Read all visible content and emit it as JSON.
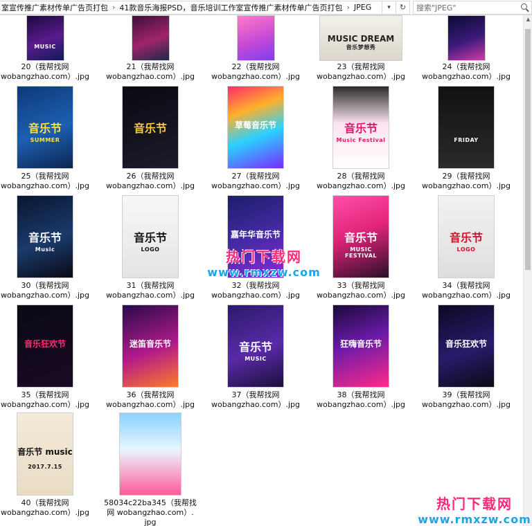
{
  "address_bar": {
    "crumbs": [
      "室宣传推广素材传单广告页打包",
      "41款音乐海报PSD，音乐培训工作室宣传推广素材传单广告页打包",
      "JPEG"
    ],
    "separator": "›",
    "search_placeholder": "搜索\"JPEG\""
  },
  "files": [
    {
      "num": "20",
      "name_line1": "20（我帮找网",
      "name_line2": "wobangzhao.com）.jpg",
      "poster_title": "",
      "poster_sub": "MUSIC",
      "bg": "linear-gradient(160deg,#1a0b3d,#5a1a8f 55%,#0d1c55)",
      "fg": "#ffffff"
    },
    {
      "num": "21",
      "name_line1": "21（我帮找网",
      "name_line2": "wobangzhao.com）.jpg",
      "poster_title": "",
      "poster_sub": "",
      "bg": "linear-gradient(160deg,#3d0f3a,#a0246a 55%,#1b2a4a)",
      "fg": "#ffd6ef"
    },
    {
      "num": "22",
      "name_line1": "22（我帮找网",
      "name_line2": "wobangzhao.com）.jpg",
      "poster_title": "",
      "poster_sub": "",
      "bg": "linear-gradient(160deg,#ff7ac8,#c64ad6 55%,#7f3cf0)",
      "fg": "#ffffff"
    },
    {
      "num": "23",
      "name_line1": "23（我帮找网",
      "name_line2": "wobangzhao.com）.jpg",
      "poster_title": "MUSIC DREAM",
      "poster_sub": "音乐梦想秀",
      "bg": "linear-gradient(180deg,#f4f1ea,#dcd7cb)",
      "fg": "#222222"
    },
    {
      "num": "24",
      "name_line1": "24（我帮找网",
      "name_line2": "wobangzhao.com）.jpg",
      "poster_title": "",
      "poster_sub": "",
      "bg": "linear-gradient(160deg,#0c0a2f,#3b1a7c 55%,#d23aa6)",
      "fg": "#ffffff"
    },
    {
      "num": "25",
      "name_line1": "25（我帮找网",
      "name_line2": "wobangzhao.com）.jpg",
      "poster_title": "音乐节",
      "poster_sub": "SUMMER",
      "bg": "linear-gradient(160deg,#0d3a7a,#1d5fb0 55%,#0b2550)",
      "fg": "#ffe23a"
    },
    {
      "num": "26",
      "name_line1": "26（我帮找网",
      "name_line2": "wobangzhao.com）.jpg",
      "poster_title": "音乐节",
      "poster_sub": "",
      "bg": "linear-gradient(160deg,#0a0a14,#1b1b2a)",
      "fg": "#ffc83a"
    },
    {
      "num": "27",
      "name_line1": "27（我帮找网",
      "name_line2": "wobangzhao.com）.jpg",
      "poster_title": "草莓音乐节",
      "poster_sub": "",
      "bg": "linear-gradient(160deg,#ff2a6d,#ffb02a 30%,#2ad1ff 60%,#7a2aff)",
      "fg": "#ffffff"
    },
    {
      "num": "28",
      "name_line1": "28（我帮找网",
      "name_line2": "wobangzhao.com）.jpg",
      "poster_title": "音乐节",
      "poster_sub": "Music Festival",
      "bg": "linear-gradient(180deg,#2a2a2a,#fbe3ef 45%,#ffffff)",
      "fg": "#e0156a"
    },
    {
      "num": "29",
      "name_line1": "29（我帮找网",
      "name_line2": "wobangzhao.com）.jpg",
      "poster_title": "",
      "poster_sub": "FRIDAY",
      "bg": "linear-gradient(180deg,#111111,#2a2a2a)",
      "fg": "#ffffff"
    },
    {
      "num": "30",
      "name_line1": "30（我帮找网",
      "name_line2": "wobangzhao.com）.jpg",
      "poster_title": "音乐节",
      "poster_sub": "Music",
      "bg": "linear-gradient(160deg,#0a1630,#1a3a6b 55%,#0a0a14)",
      "fg": "#ffffff"
    },
    {
      "num": "31",
      "name_line1": "31（我帮找网",
      "name_line2": "wobangzhao.com）.jpg",
      "poster_title": "音乐节",
      "poster_sub": "LOGO",
      "bg": "linear-gradient(180deg,#f7f7f7,#e4e4e4)",
      "fg": "#111111"
    },
    {
      "num": "32",
      "name_line1": "32（我帮找网",
      "name_line2": "wobangzhao.com）.jpg",
      "poster_title": "嘉年华音乐节",
      "poster_sub": "",
      "bg": "linear-gradient(160deg,#1a1f6b,#4a2aa8 55%,#8a2ad6)",
      "fg": "#ffffff"
    },
    {
      "num": "33",
      "name_line1": "33（我帮找网",
      "name_line2": "wobangzhao.com）.jpg",
      "poster_title": "音乐节",
      "poster_sub": "MUSIC FESTIVAL",
      "bg": "linear-gradient(160deg,#ff4fa8,#e1247a 45%,#2a0f2a)",
      "fg": "#ffffff"
    },
    {
      "num": "34",
      "name_line1": "34（我帮找网",
      "name_line2": "wobangzhao.com）.jpg",
      "poster_title": "音乐节",
      "poster_sub": "LOGO",
      "bg": "linear-gradient(180deg,#f2f2f2,#dedede)",
      "fg": "#d0102a"
    },
    {
      "num": "35",
      "name_line1": "35（我帮找网",
      "name_line2": "wobangzhao.com）.jpg",
      "poster_title": "音乐狂欢节",
      "poster_sub": "",
      "bg": "linear-gradient(160deg,#0a0a14,#1a0a24)",
      "fg": "#ff2a6d"
    },
    {
      "num": "36",
      "name_line1": "36（我帮找网",
      "name_line2": "wobangzhao.com）.jpg",
      "poster_title": "迷笛音乐节",
      "poster_sub": "",
      "bg": "linear-gradient(160deg,#2a0a4a,#b01a8a 55%,#ff7a2a)",
      "fg": "#ffffff"
    },
    {
      "num": "37",
      "name_line1": "37（我帮找网",
      "name_line2": "wobangzhao.com）.jpg",
      "poster_title": "音乐节",
      "poster_sub": "MUSIC",
      "bg": "linear-gradient(160deg,#2a1a6b,#5a2aa8 55%,#1a0f3a)",
      "fg": "#ffffff"
    },
    {
      "num": "38",
      "name_line1": "38（我帮找网",
      "name_line2": "wobangzhao.com）.jpg",
      "poster_title": "狂嗨音乐节",
      "poster_sub": "",
      "bg": "linear-gradient(160deg,#1a0a3a,#6a1aa8 45%,#ff2a8a)",
      "fg": "#ffffff"
    },
    {
      "num": "39",
      "name_line1": "39（我帮找网",
      "name_line2": "wobangzhao.com）.jpg",
      "poster_title": "音乐狂欢节",
      "poster_sub": "",
      "bg": "linear-gradient(160deg,#0a0a24,#2a1a6b 55%,#0a0a14)",
      "fg": "#ffffff"
    },
    {
      "num": "40",
      "name_line1": "40（我帮找网",
      "name_line2": "wobangzhao.com）.jpg",
      "poster_title": "音乐节 music",
      "poster_sub": "2017.7.15",
      "bg": "linear-gradient(180deg,#f4ead8,#e8dcc4)",
      "fg": "#111111"
    },
    {
      "num": "58034c22ba345",
      "name_line1": "58034c22ba345（我帮找",
      "name_line2": "网 wobangzhao.com）.",
      "name_line3": "jpg",
      "poster_title": "",
      "poster_sub": "",
      "bg": "linear-gradient(180deg,#8ad2ff,#e8f6ff 45%,#ff5a9a)",
      "fg": "#ffffff"
    }
  ],
  "watermarks": [
    {
      "line1": "热门下载网",
      "line2": "www.rmxzw.com"
    },
    {
      "line1": "热门下载网",
      "line2": "www.rmxzw.com"
    }
  ],
  "colors": {
    "watermark_pink": "#ff2a7a",
    "watermark_blue": "#1da4e6",
    "border": "#d9d9d9"
  }
}
